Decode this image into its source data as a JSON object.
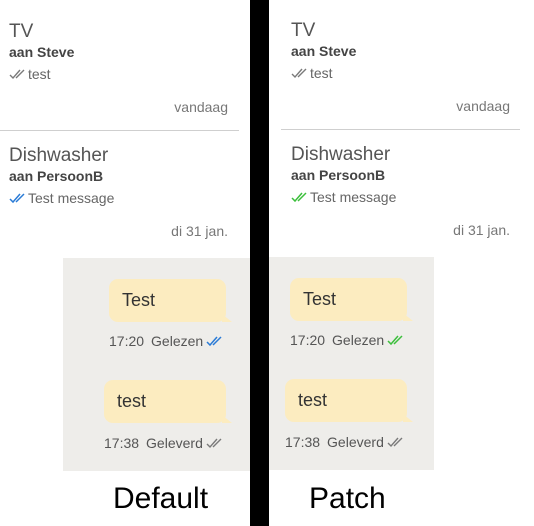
{
  "colors": {
    "tick_read_default": "#2a7bd6",
    "tick_read_patch": "#3cbf3c",
    "tick_delivered": "#7a7a7a",
    "bubble": "#fcecc0",
    "chat_background": "#eeedea",
    "divider": "#000000"
  },
  "panels": [
    {
      "id": "default",
      "caption": "Default",
      "conversations": [
        {
          "title": "TV",
          "recipient": "aan Steve",
          "preview": "test",
          "preview_tick": "delivered",
          "date": "vandaag"
        },
        {
          "title": "Dishwasher",
          "recipient": "aan PersoonB",
          "preview": "Test message",
          "preview_tick": "read",
          "date": "di 31 jan."
        }
      ],
      "messages": [
        {
          "text": "Test",
          "time": "17:20",
          "status": "Gelezen",
          "tick": "read"
        },
        {
          "text": "test",
          "time": "17:38",
          "status": "Geleverd",
          "tick": "delivered"
        }
      ]
    },
    {
      "id": "patch",
      "caption": "Patch",
      "conversations": [
        {
          "title": "TV",
          "recipient": "aan Steve",
          "preview": "test",
          "preview_tick": "delivered",
          "date": "vandaag"
        },
        {
          "title": "Dishwasher",
          "recipient": "aan PersoonB",
          "preview": "Test message",
          "preview_tick": "read",
          "date": "di 31 jan."
        }
      ],
      "messages": [
        {
          "text": "Test",
          "time": "17:20",
          "status": "Gelezen",
          "tick": "read"
        },
        {
          "text": "test",
          "time": "17:38",
          "status": "Geleverd",
          "tick": "delivered"
        }
      ]
    }
  ]
}
